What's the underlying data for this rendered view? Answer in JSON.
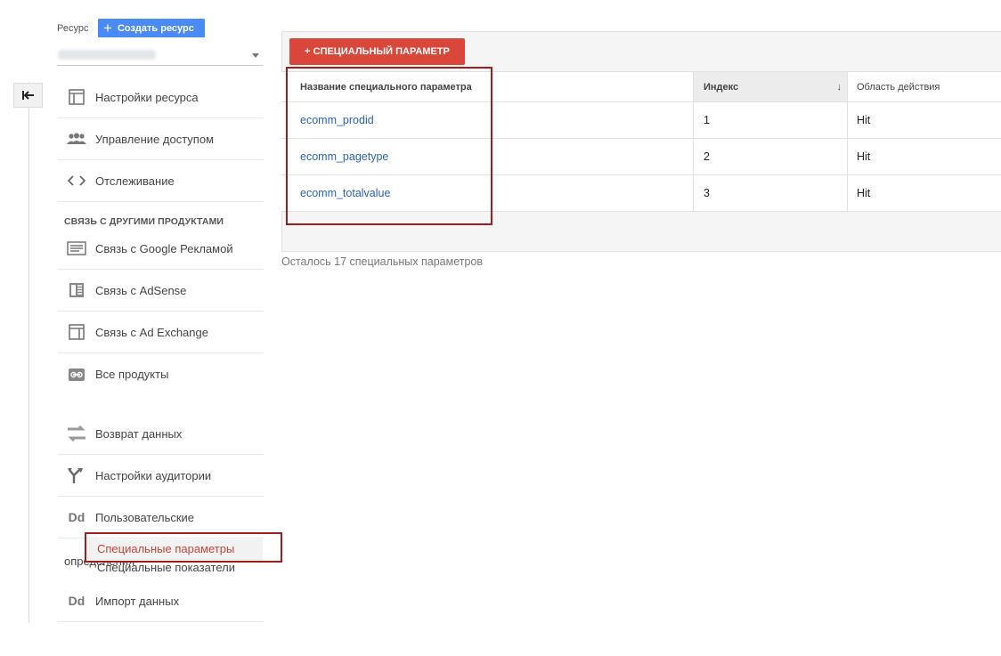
{
  "property": {
    "label": "Ресурс",
    "create_label": "Создать ресурс"
  },
  "nav": {
    "resource_settings": "Настройки ресурса",
    "access_management": "Управление доступом",
    "tracking": "Отслеживание",
    "linking_section": "СВЯЗЬ С ДРУГИМИ ПРОДУКТАМИ",
    "google_ads": "Связь с Google Рекламой",
    "adsense": "Связь с AdSense",
    "ad_exchange": "Связь с Ad Exchange",
    "all_products": "Все продукты",
    "data_return": "Возврат данных",
    "audience_settings": "Настройки аудитории",
    "custom_definitions_line1": "Пользовательские",
    "custom_definitions_line2": "определения",
    "custom_dimensions": "Специальные параметры",
    "custom_metrics": "Специальные показатели",
    "data_import": "Импорт данных",
    "dd_label": "Dd"
  },
  "main": {
    "add_button": "+ СПЕЦИАЛЬНЫЙ ПАРАМЕТР",
    "table": {
      "headers": [
        "Название специального параметра",
        "Индекс",
        "Область действия"
      ],
      "sort_indicator": "↓",
      "rows": [
        {
          "name": "ecomm_prodid",
          "index": "1",
          "scope": "Hit"
        },
        {
          "name": "ecomm_pagetype",
          "index": "2",
          "scope": "Hit"
        },
        {
          "name": "ecomm_totalvalue",
          "index": "3",
          "scope": "Hit"
        }
      ]
    },
    "remaining": "Осталось 17 специальных параметров"
  },
  "colors": {
    "accent_blue": "#4a8af4",
    "add_red": "#d9473b",
    "link_blue": "#2a63b8",
    "highlight_box": "#9c1f1f"
  }
}
